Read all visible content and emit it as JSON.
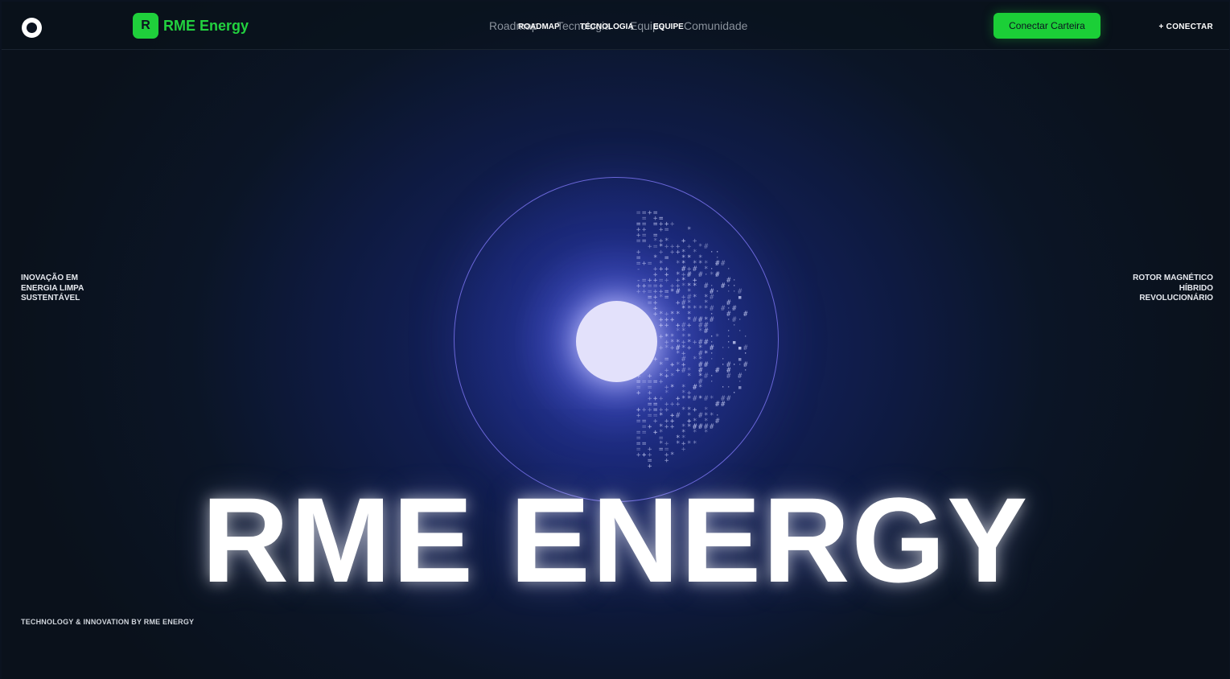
{
  "topbar": {
    "brand_letter": "R",
    "brand_name": "RME Energy",
    "nav_ghost": [
      "Roadmap",
      "Tecnologia",
      "Equipe",
      "Comunidade"
    ],
    "nav_main": [
      "ROADMAP",
      "TECNOLOGIA",
      "EQUIPE"
    ],
    "connect_wallet": "Conectar Carteira",
    "connect_link": "+ CONECTAR"
  },
  "hero": {
    "left_text": "INOVAÇÃO EM\nENERGIA LIMPA\nSUSTENTÁVEL",
    "right_text": "ROTOR MAGNÉTICO\nHÍBRIDO\nREVOLUCIONÁRIO",
    "title": "RME ENERGY",
    "footer": "TECHNOLOGY & INNOVATION BY RME ENERGY"
  },
  "colors": {
    "accent": "#1fcf3b",
    "background": "#0b1320",
    "orb_ring": "#6a66d8",
    "orb_core": "#e3e1fb"
  },
  "icons": {
    "logo": "ring-logo-icon",
    "orb": "energy-orb-icon"
  }
}
